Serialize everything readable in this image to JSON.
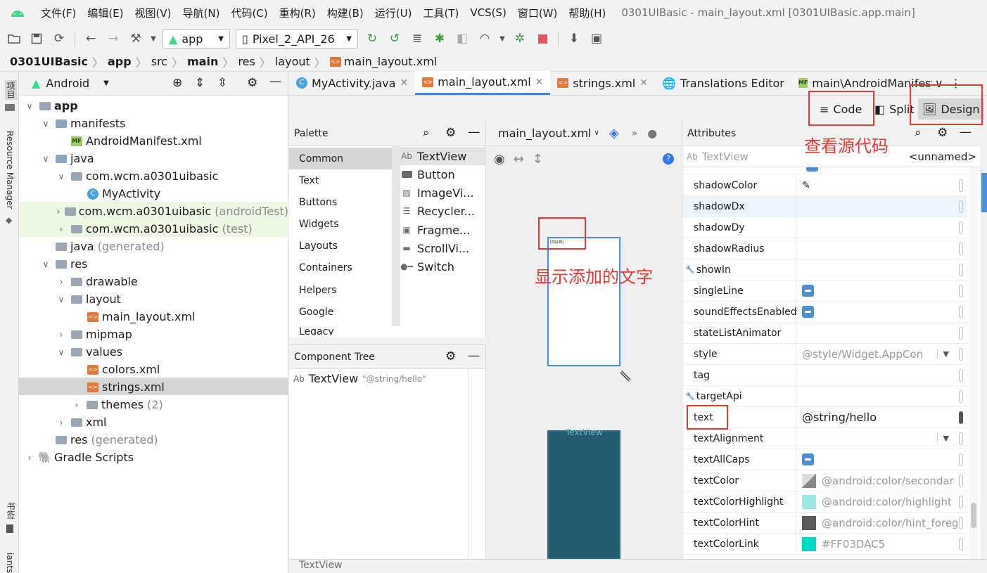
{
  "menu": {
    "items": [
      "文件(F)",
      "编辑(E)",
      "视图(V)",
      "导航(N)",
      "代码(C)",
      "重构(R)",
      "构建(B)",
      "运行(U)",
      "工具(T)",
      "VCS(S)",
      "窗口(W)",
      "帮助(H)"
    ],
    "window_title": "0301UIBasic - main_layout.xml [0301UIBasic.app.main]"
  },
  "toolbar": {
    "module": "app",
    "device": "Pixel_2_API_26"
  },
  "breadcrumbs": [
    "0301UIBasic",
    "app",
    "src",
    "main",
    "res",
    "layout",
    "main_layout.xml"
  ],
  "left_strip": {
    "project": "项目",
    "resource_manager": "Resource Manager",
    "bookmarks": "书签",
    "variants": "iants"
  },
  "project": {
    "view": "Android",
    "tree": [
      {
        "label": "app",
        "bold": true
      },
      {
        "label": "manifests"
      },
      {
        "label": "AndroidManifest.xml"
      },
      {
        "label": "java"
      },
      {
        "label": "com.wcm.a0301uibasic"
      },
      {
        "label": "MyActivity"
      },
      {
        "label": "com.wcm.a0301uibasic",
        "suffix": "(androidTest)"
      },
      {
        "label": "com.wcm.a0301uibasic",
        "suffix": "(test)"
      },
      {
        "label": "java",
        "suffix": "(generated)"
      },
      {
        "label": "res"
      },
      {
        "label": "drawable"
      },
      {
        "label": "layout"
      },
      {
        "label": "main_layout.xml"
      },
      {
        "label": "mipmap"
      },
      {
        "label": "values"
      },
      {
        "label": "colors.xml"
      },
      {
        "label": "strings.xml"
      },
      {
        "label": "themes",
        "suffix": "(2)"
      },
      {
        "label": "xml"
      },
      {
        "label": "res",
        "suffix": "(generated)"
      },
      {
        "label": "Gradle Scripts"
      }
    ]
  },
  "tabs": [
    "MyActivity.java",
    "main_layout.xml",
    "strings.xml",
    "Translations Editor",
    "main\\AndroidManifest.xı"
  ],
  "modes": {
    "code": "Code",
    "split": "Split",
    "design": "Design"
  },
  "palette": {
    "title": "Palette",
    "categories": [
      "Common",
      "Text",
      "Buttons",
      "Widgets",
      "Layouts",
      "Containers",
      "Helpers",
      "Google",
      "Legacy"
    ],
    "items": [
      "TextView",
      "Button",
      "ImageVi...",
      "Recycler...",
      "Fragme...",
      "ScrollVi...",
      "Switch"
    ]
  },
  "component_tree": {
    "title": "Component Tree",
    "node": "TextView",
    "node_value": "\"@string/hello\""
  },
  "design_surface": {
    "file": "main_layout.xml",
    "preview_label": "TextView",
    "preview_tiny": "[你好啊]"
  },
  "attributes": {
    "title": "Attributes",
    "widget": "TextView",
    "id": "<unnamed>",
    "rows": [
      {
        "name": "shadowColor",
        "value": ""
      },
      {
        "name": "shadowDx",
        "value": ""
      },
      {
        "name": "shadowDy",
        "value": ""
      },
      {
        "name": "shadowRadius",
        "value": ""
      },
      {
        "name": "showIn",
        "value": ""
      },
      {
        "name": "singleLine",
        "value": ""
      },
      {
        "name": "soundEffectsEnabled",
        "value": ""
      },
      {
        "name": "stateListAnimator",
        "value": ""
      },
      {
        "name": "style",
        "value": "@style/Widget.AppCon"
      },
      {
        "name": "tag",
        "value": ""
      },
      {
        "name": "targetApi",
        "value": ""
      },
      {
        "name": "text",
        "value": "@string/hello"
      },
      {
        "name": "textAlignment",
        "value": ""
      },
      {
        "name": "textAllCaps",
        "value": ""
      },
      {
        "name": "textColor",
        "value": "@android:color/secondar"
      },
      {
        "name": "textColorHighlight",
        "value": "@android:color/highlight"
      },
      {
        "name": "textColorHint",
        "value": "@android:color/hint_foreg"
      },
      {
        "name": "textColorLink",
        "value": "#FF03DAC5"
      }
    ],
    "colors": {
      "highlight": "#9fe8e6",
      "hint": "#5a5a5a",
      "link": "#03DAC5"
    }
  },
  "annotations": {
    "view_source": "查看源代码",
    "shows_added_text": "显示添加的文字"
  },
  "status": {
    "text": "TextView"
  }
}
